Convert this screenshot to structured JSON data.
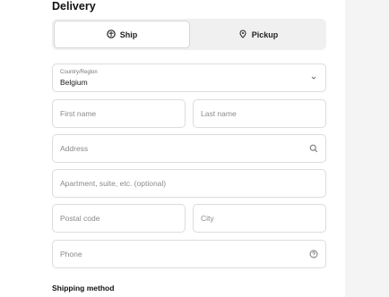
{
  "delivery": {
    "title": "Delivery",
    "options": [
      {
        "label": "Ship",
        "icon": "truck-icon",
        "selected": true
      },
      {
        "label": "Pickup",
        "icon": "location-pin-icon",
        "selected": false
      }
    ]
  },
  "country": {
    "label": "Country/Region",
    "value": "Belgium"
  },
  "fields": {
    "first_name": {
      "placeholder": "First name"
    },
    "last_name": {
      "placeholder": "Last name"
    },
    "address": {
      "placeholder": "Address"
    },
    "apartment": {
      "placeholder": "Apartment, suite, etc. (optional)"
    },
    "postal_code": {
      "placeholder": "Postal code"
    },
    "city": {
      "placeholder": "City"
    },
    "phone": {
      "placeholder": "Phone"
    }
  },
  "shipping": {
    "title": "Shipping method"
  },
  "colors": {
    "border": "#dcdcdc",
    "toggle_bg": "#f0f0f0",
    "side_panel": "#f4f4f4"
  }
}
